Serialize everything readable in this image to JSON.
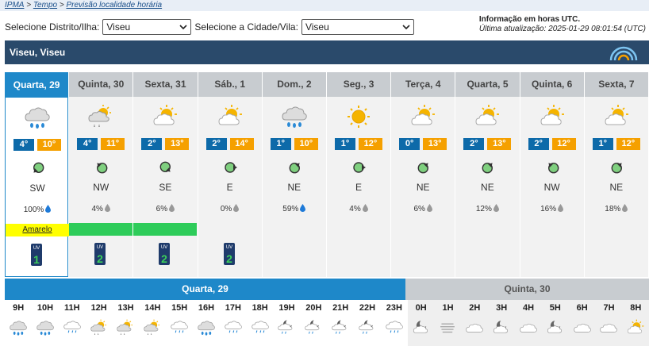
{
  "breadcrumb": {
    "home": "IPMA",
    "sep": ">",
    "tempo": "Tempo",
    "page": "Previsão localidade horária"
  },
  "selectors": {
    "district_label": "Selecione Distrito/Ilha:",
    "district_value": "Viseu",
    "city_label": "Selecione a Cidade/Vila:",
    "city_value": "Viseu"
  },
  "info": {
    "line1": "Informação em horas UTC.",
    "line2": "Última atualização: 2025-01-29 08:01:54 (UTC)"
  },
  "location": "Viseu, Viseu",
  "days": [
    {
      "label": "Quarta, 29",
      "icon": "rain-cloud-icon",
      "min": "4°",
      "max": "10°",
      "wind_rot": 225,
      "dir": "SW",
      "prec": "100%",
      "drop": "blue",
      "warn": "Amarelo",
      "warn_color": "yellow",
      "uv": "1"
    },
    {
      "label": "Quinta, 30",
      "icon": "sun-cloud-rain-icon",
      "min": "4°",
      "max": "11°",
      "wind_rot": 315,
      "dir": "NW",
      "prec": "4%",
      "drop": "grey",
      "warn": "",
      "warn_color": "green",
      "uv": "2"
    },
    {
      "label": "Sexta, 31",
      "icon": "sun-cloud-icon",
      "min": "2°",
      "max": "13°",
      "wind_rot": 135,
      "dir": "SE",
      "prec": "6%",
      "drop": "grey",
      "warn": "",
      "warn_color": "green",
      "uv": "2"
    },
    {
      "label": "Sáb., 1",
      "icon": "sun-cloud-icon",
      "min": "2°",
      "max": "14°",
      "wind_rot": 90,
      "dir": "E",
      "prec": "0%",
      "drop": "grey",
      "warn": "",
      "warn_color": "",
      "uv": "2"
    },
    {
      "label": "Dom., 2",
      "icon": "rain-cloud-icon",
      "min": "1°",
      "max": "10°",
      "wind_rot": 45,
      "dir": "NE",
      "prec": "59%",
      "drop": "blue",
      "warn": "",
      "warn_color": "",
      "uv": ""
    },
    {
      "label": "Seg., 3",
      "icon": "sun-icon",
      "min": "1°",
      "max": "12°",
      "wind_rot": 90,
      "dir": "E",
      "prec": "4%",
      "drop": "grey",
      "warn": "",
      "warn_color": "",
      "uv": ""
    },
    {
      "label": "Terça, 4",
      "icon": "sun-cloud-icon",
      "min": "0°",
      "max": "13°",
      "wind_rot": 45,
      "dir": "NE",
      "prec": "6%",
      "drop": "grey",
      "warn": "",
      "warn_color": "",
      "uv": ""
    },
    {
      "label": "Quarta, 5",
      "icon": "sun-cloud-icon",
      "min": "2°",
      "max": "13°",
      "wind_rot": 45,
      "dir": "NE",
      "prec": "12%",
      "drop": "grey",
      "warn": "",
      "warn_color": "",
      "uv": ""
    },
    {
      "label": "Quinta, 6",
      "icon": "sun-cloud-icon",
      "min": "2°",
      "max": "12°",
      "wind_rot": 315,
      "dir": "NW",
      "prec": "16%",
      "drop": "grey",
      "warn": "",
      "warn_color": "",
      "uv": ""
    },
    {
      "label": "Sexta, 7",
      "icon": "sun-cloud-icon",
      "min": "1°",
      "max": "12°",
      "wind_rot": 45,
      "dir": "NE",
      "prec": "18%",
      "drop": "grey",
      "warn": "",
      "warn_color": "",
      "uv": ""
    }
  ],
  "hourly": {
    "day1": "Quarta, 29",
    "day2": "Quinta, 30",
    "hours": [
      {
        "h": "9H",
        "icon": "rain-cloud-icon"
      },
      {
        "h": "10H",
        "icon": "rain-cloud-icon"
      },
      {
        "h": "11H",
        "icon": "drizzle-cloud-icon"
      },
      {
        "h": "12H",
        "icon": "sun-cloud-rain-icon"
      },
      {
        "h": "13H",
        "icon": "sun-cloud-rain-icon"
      },
      {
        "h": "14H",
        "icon": "sun-cloud-rain-icon"
      },
      {
        "h": "15H",
        "icon": "drizzle-cloud-icon"
      },
      {
        "h": "16H",
        "icon": "rain-cloud-icon"
      },
      {
        "h": "17H",
        "icon": "drizzle-cloud-icon"
      },
      {
        "h": "18H",
        "icon": "drizzle-cloud-icon"
      },
      {
        "h": "19H",
        "icon": "moon-cloud-rain-icon"
      },
      {
        "h": "20H",
        "icon": "moon-cloud-rain-icon"
      },
      {
        "h": "21H",
        "icon": "moon-cloud-rain-icon"
      },
      {
        "h": "22H",
        "icon": "moon-cloud-rain-icon"
      },
      {
        "h": "23H",
        "icon": "drizzle-cloud-icon"
      },
      {
        "h": "0H",
        "icon": "moon-cloud-icon"
      },
      {
        "h": "1H",
        "icon": "fog-icon"
      },
      {
        "h": "2H",
        "icon": "cloud-icon"
      },
      {
        "h": "3H",
        "icon": "moon-cloud-icon"
      },
      {
        "h": "4H",
        "icon": "cloud-icon"
      },
      {
        "h": "5H",
        "icon": "moon-cloud-icon"
      },
      {
        "h": "6H",
        "icon": "cloud-icon"
      },
      {
        "h": "7H",
        "icon": "cloud-icon"
      },
      {
        "h": "8H",
        "icon": "sun-cloud-icon"
      }
    ]
  },
  "colors": {
    "header": "#2a4a6b",
    "accent": "#1e88c9",
    "min": "#0d6aa9",
    "max": "#f5a000",
    "warn_yellow": "#ffff00",
    "warn_green": "#2ecc5a"
  }
}
